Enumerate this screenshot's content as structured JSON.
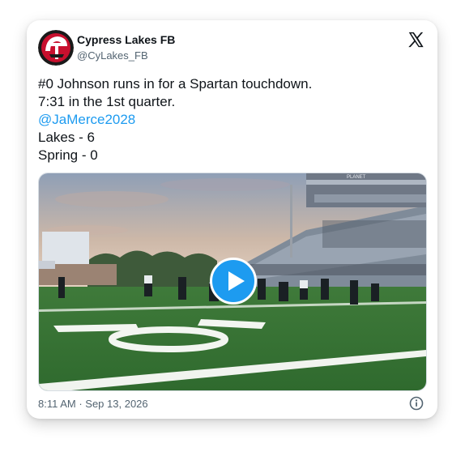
{
  "tweet": {
    "author_name": "Cypress Lakes FB",
    "author_handle": "@CyLakes_FB",
    "lines": [
      "#0 Johnson runs in for a Spartan touchdown.",
      "7:31 in the 1st quarter."
    ],
    "mention": "@JaMerce2028",
    "score_lines": [
      "Lakes - 6",
      "Spring - 0"
    ],
    "timestamp": "8:11 AM · Sep 13, 2026"
  },
  "media": {
    "type": "video",
    "field_number": "10",
    "stadium_sign": "PLANET"
  },
  "icons": {
    "brand": "x-logo-icon",
    "play": "play-icon",
    "info": "info-icon",
    "avatar": "team-logo-icon"
  },
  "colors": {
    "accent_link": "#1d9bf0",
    "text": "#0f1419",
    "muted": "#536471",
    "team_red": "#c8102e"
  }
}
